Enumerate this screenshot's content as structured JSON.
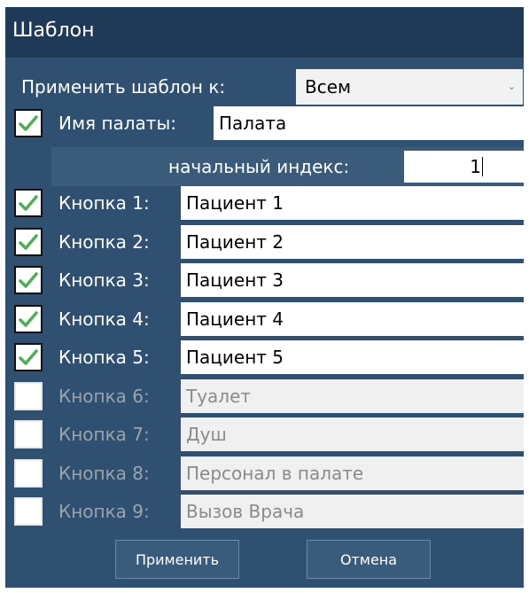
{
  "window": {
    "title": "Шаблон"
  },
  "apply_to": {
    "label": "Применить шаблон к:",
    "selected": "Всем"
  },
  "ward_name": {
    "label": "Имя палаты:",
    "value": "Палата",
    "checked": true
  },
  "start_index": {
    "label": "начальный индекс:",
    "value": "1"
  },
  "buttons": [
    {
      "label": "Кнопка 1:",
      "value": "Пациент 1",
      "checked": true
    },
    {
      "label": "Кнопка 2:",
      "value": "Пациент 2",
      "checked": true
    },
    {
      "label": "Кнопка 3:",
      "value": "Пациент 3",
      "checked": true
    },
    {
      "label": "Кнопка 4:",
      "value": "Пациент 4",
      "checked": true
    },
    {
      "label": "Кнопка 5:",
      "value": "Пациент 5",
      "checked": true
    },
    {
      "label": "Кнопка 6:",
      "value": "Туалет",
      "checked": false
    },
    {
      "label": "Кнопка 7:",
      "value": "Душ",
      "checked": false
    },
    {
      "label": "Кнопка 8:",
      "value": "Персонал в палате",
      "checked": false
    },
    {
      "label": "Кнопка 9:",
      "value": "Вызов Врача",
      "checked": false
    }
  ],
  "actions": {
    "apply_label": "Применить",
    "cancel_label": "Отмена"
  },
  "colors": {
    "window_bg": "#2f5070",
    "title_bg": "#1f3a57",
    "check_green": "#4caf50"
  }
}
